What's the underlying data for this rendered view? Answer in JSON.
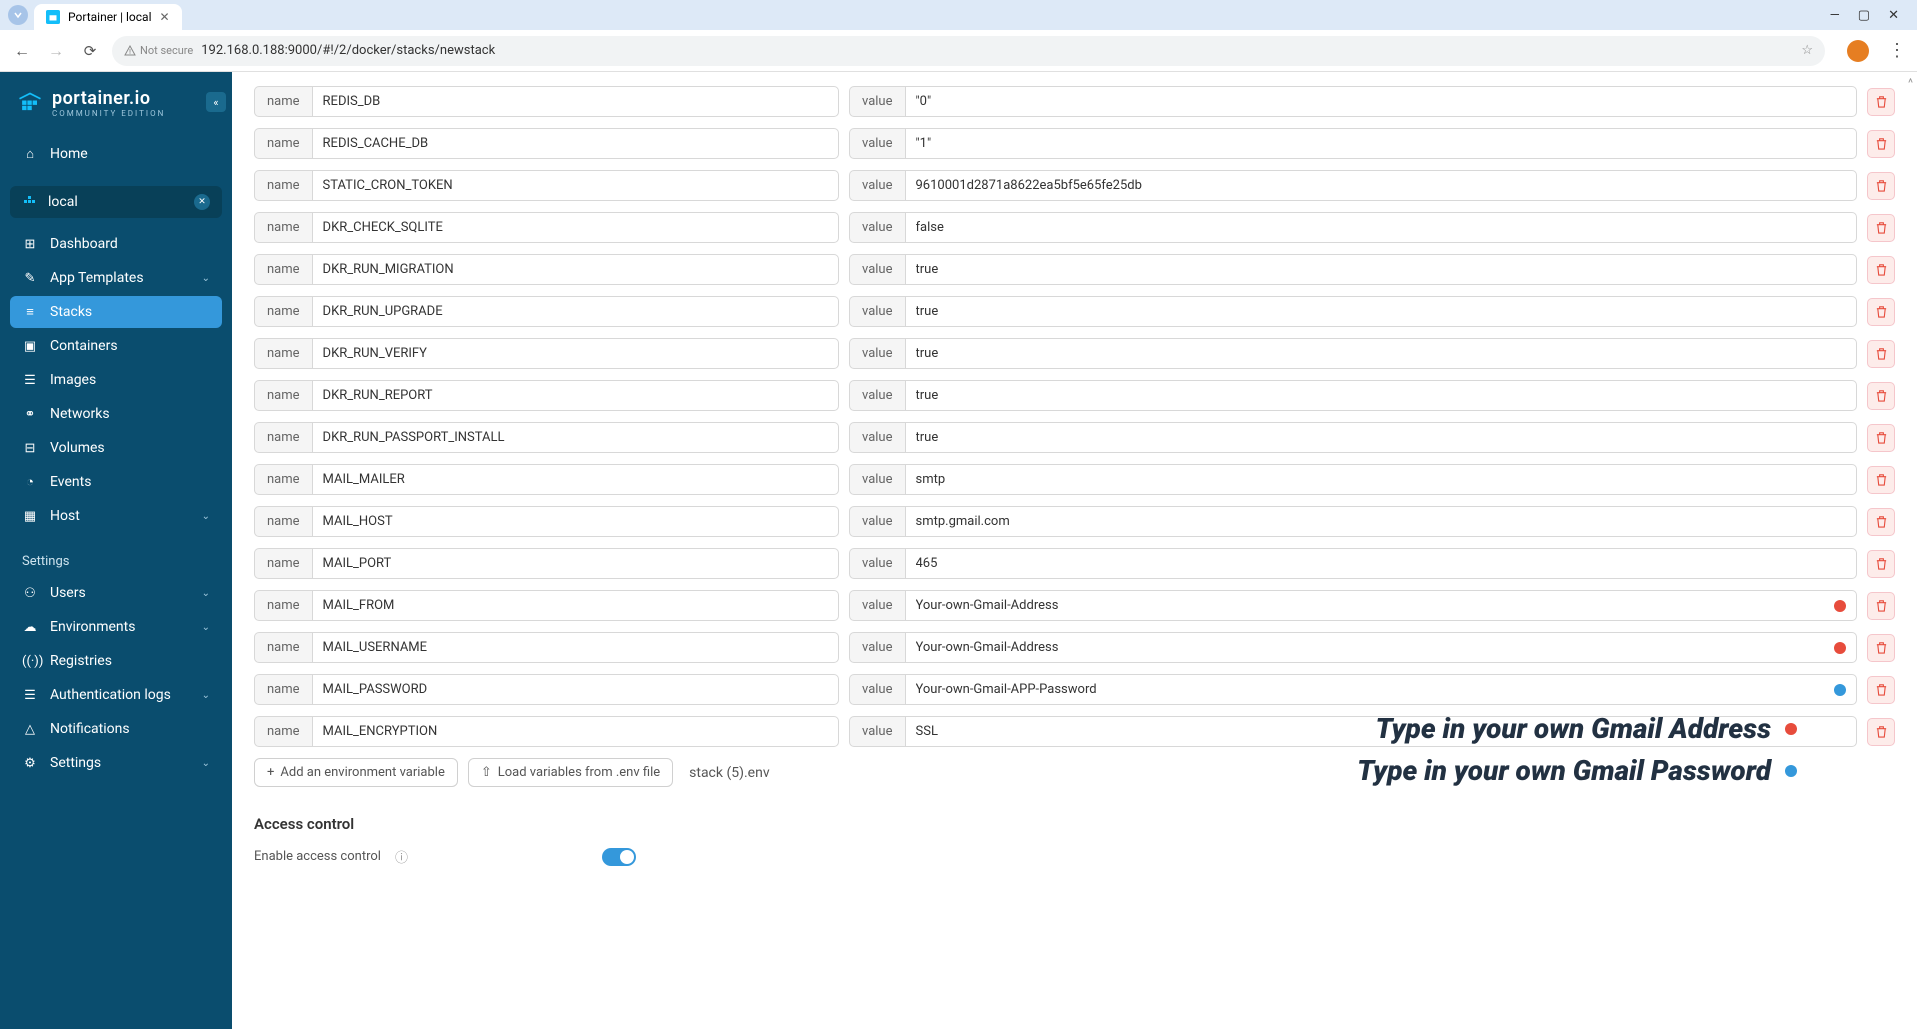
{
  "browser": {
    "tab_title": "Portainer | local",
    "url": "192.168.0.188:9000/#!/2/docker/stacks/newstack",
    "security_label": "Not secure"
  },
  "sidebar": {
    "logo_main": "portainer.io",
    "logo_sub": "COMMUNITY EDITION",
    "home": "Home",
    "env_name": "local",
    "items": [
      {
        "icon": "dashboard",
        "label": "Dashboard"
      },
      {
        "icon": "templates",
        "label": "App Templates",
        "chevron": true
      },
      {
        "icon": "stacks",
        "label": "Stacks",
        "active": true
      },
      {
        "icon": "containers",
        "label": "Containers"
      },
      {
        "icon": "images",
        "label": "Images"
      },
      {
        "icon": "networks",
        "label": "Networks"
      },
      {
        "icon": "volumes",
        "label": "Volumes"
      },
      {
        "icon": "events",
        "label": "Events"
      },
      {
        "icon": "host",
        "label": "Host",
        "chevron": true
      }
    ],
    "settings_header": "Settings",
    "settings_items": [
      {
        "icon": "users",
        "label": "Users",
        "chevron": true
      },
      {
        "icon": "environments",
        "label": "Environments",
        "chevron": true
      },
      {
        "icon": "registries",
        "label": "Registries"
      },
      {
        "icon": "auth",
        "label": "Authentication logs",
        "chevron": true
      },
      {
        "icon": "notifications",
        "label": "Notifications"
      },
      {
        "icon": "settings",
        "label": "Settings",
        "chevron": true
      }
    ]
  },
  "env_vars": [
    {
      "name": "REDIS_DB",
      "value": "\"0\""
    },
    {
      "name": "REDIS_CACHE_DB",
      "value": "\"1\""
    },
    {
      "name": "STATIC_CRON_TOKEN",
      "value": "9610001d2871a8622ea5bf5e65fe25db"
    },
    {
      "name": "DKR_CHECK_SQLITE",
      "value": "false"
    },
    {
      "name": "DKR_RUN_MIGRATION",
      "value": "true"
    },
    {
      "name": "DKR_RUN_UPGRADE",
      "value": "true"
    },
    {
      "name": "DKR_RUN_VERIFY",
      "value": "true"
    },
    {
      "name": "DKR_RUN_REPORT",
      "value": "true"
    },
    {
      "name": "DKR_RUN_PASSPORT_INSTALL",
      "value": "true"
    },
    {
      "name": "MAIL_MAILER",
      "value": "smtp"
    },
    {
      "name": "MAIL_HOST",
      "value": "smtp.gmail.com"
    },
    {
      "name": "MAIL_PORT",
      "value": "465"
    },
    {
      "name": "MAIL_FROM",
      "value": "Your-own-Gmail-Address",
      "dot": "red"
    },
    {
      "name": "MAIL_USERNAME",
      "value": "Your-own-Gmail-Address",
      "dot": "red"
    },
    {
      "name": "MAIL_PASSWORD",
      "value": "Your-own-Gmail-APP-Password",
      "dot": "blue"
    },
    {
      "name": "MAIL_ENCRYPTION",
      "value": "SSL"
    }
  ],
  "labels": {
    "name": "name",
    "value": "value",
    "add_env": "Add an environment variable",
    "load_env": "Load variables from .env file",
    "stack_file": "stack (5).env",
    "access_control": "Access control",
    "enable_access": "Enable access control"
  },
  "overlay": {
    "line1": "Type in your own Gmail Address",
    "line2": "Type in your own Gmail Password"
  }
}
